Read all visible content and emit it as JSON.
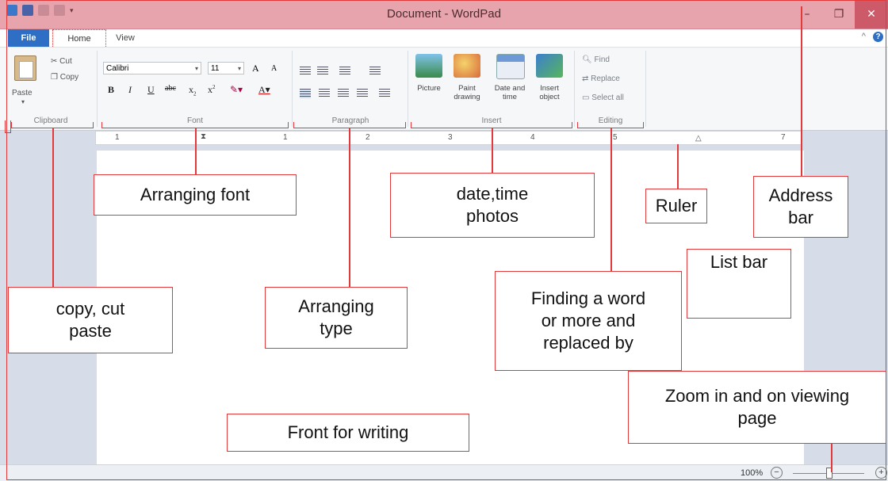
{
  "window": {
    "title": "Document - WordPad"
  },
  "tabs": {
    "file": "File",
    "home": "Home",
    "view": "View"
  },
  "ribbon": {
    "clipboard": {
      "group_label": "Clipboard",
      "paste": "Paste",
      "cut": "Cut",
      "copy": "Copy"
    },
    "font": {
      "group_label": "Font",
      "font_name": "Calibri",
      "font_size": "11",
      "grow": "A",
      "shrink": "A",
      "bold": "B",
      "italic": "I",
      "underline": "U",
      "strike": "abc",
      "sub": "x",
      "sup": "x"
    },
    "paragraph": {
      "group_label": "Paragraph"
    },
    "insert": {
      "group_label": "Insert",
      "picture": "Picture",
      "paint": "Paint\ndrawing",
      "datetime": "Date and\ntime",
      "object": "Insert\nobject"
    },
    "editing": {
      "group_label": "Editing",
      "find": "Find",
      "replace": "Replace",
      "select_all": "Select all"
    }
  },
  "ruler": {
    "numbers": [
      "1",
      "1",
      "2",
      "3",
      "4",
      "5",
      "7"
    ]
  },
  "statusbar": {
    "zoom": "100%",
    "zoom_out": "−",
    "zoom_in": "+"
  },
  "annotations": {
    "font": "Arranging font",
    "datetime": "date,time\nphotos",
    "ruler": "Ruler",
    "address": "Address\nbar",
    "list": "List bar",
    "finding": "Finding a word\nor more and\nreplaced by",
    "copy": "copy, cut\npaste",
    "type": "Arranging\ntype",
    "zoom": "Zoom in and on viewing\npage",
    "front": "Front for writing"
  },
  "colors": {
    "titlebar": "#e8a4ad",
    "file_tab": "#2e6fc5",
    "annotation": "#e23a3a",
    "workspace": "#d6dde8"
  }
}
